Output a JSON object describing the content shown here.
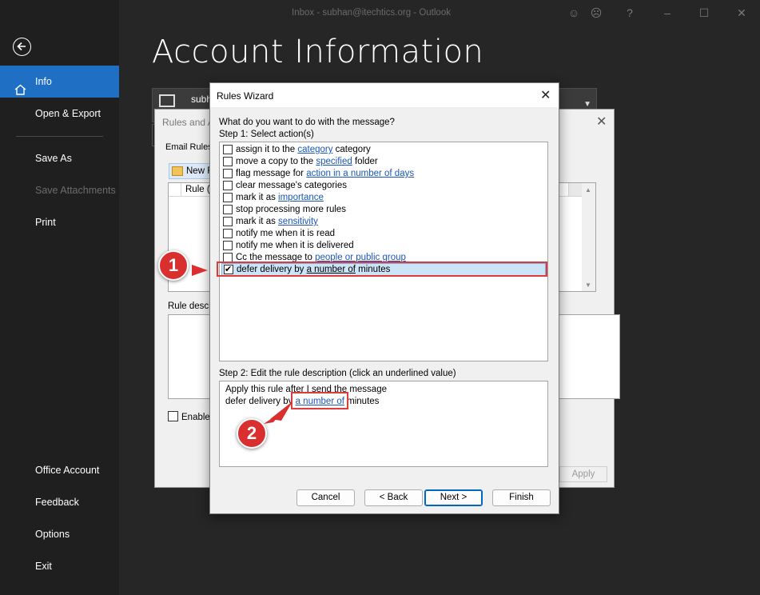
{
  "window": {
    "title": "Inbox - subhan@itechtics.org  -  Outlook"
  },
  "sidebar": {
    "items": [
      {
        "label": "Info",
        "active": true
      },
      {
        "label": "Open & Export"
      },
      {
        "label": "Save As"
      },
      {
        "label": "Save Attachments",
        "disabled": true
      },
      {
        "label": "Print"
      },
      {
        "label": "Office Account"
      },
      {
        "label": "Feedback"
      },
      {
        "label": "Options"
      },
      {
        "label": "Exit"
      }
    ]
  },
  "page": {
    "title": "Account Information",
    "account_text": "subh"
  },
  "rules_alerts": {
    "title": "Rules and A",
    "tab": "Email Rules",
    "new_rule": "New R",
    "column_rule": "Rule (a",
    "description_label": "Rule descr",
    "enable_label": "Enable",
    "apply_label": "Apply"
  },
  "wizard": {
    "title": "Rules Wizard",
    "question": "What do you want to do with the message?",
    "step1": "Step 1: Select action(s)",
    "actions": [
      {
        "pre": "assign it to the ",
        "link": "category",
        "post": " category",
        "checked": false
      },
      {
        "pre": "move a copy to the ",
        "link": "specified",
        "post": " folder",
        "checked": false
      },
      {
        "pre": "flag message for ",
        "link": "action in a number of days",
        "post": "",
        "checked": false
      },
      {
        "pre": "clear message's categories",
        "link": "",
        "post": "",
        "checked": false
      },
      {
        "pre": "mark it as ",
        "link": "importance",
        "post": "",
        "checked": false
      },
      {
        "pre": "stop processing more rules",
        "link": "",
        "post": "",
        "checked": false
      },
      {
        "pre": "mark it as ",
        "link": "sensitivity",
        "post": "",
        "checked": false
      },
      {
        "pre": "notify me when it is read",
        "link": "",
        "post": "",
        "checked": false
      },
      {
        "pre": "notify me when it is delivered",
        "link": "",
        "post": "",
        "checked": false
      },
      {
        "pre": "Cc the message to ",
        "link": "people or public group",
        "post": "",
        "checked": false
      },
      {
        "pre": "defer delivery by ",
        "link": "a number of",
        "post": " minutes",
        "checked": true
      }
    ],
    "step2": "Step 2: Edit the rule description (click an underlined value)",
    "description": {
      "line1": "Apply this rule after I send the message",
      "line2_pre": "defer delivery by ",
      "line2_link": "a number of",
      "line2_post": " minutes"
    },
    "buttons": {
      "cancel": "Cancel",
      "back": "< Back",
      "next": "Next >",
      "finish": "Finish"
    }
  },
  "annotations": {
    "badge1": "1",
    "badge2": "2",
    "color": "#d9302f"
  }
}
